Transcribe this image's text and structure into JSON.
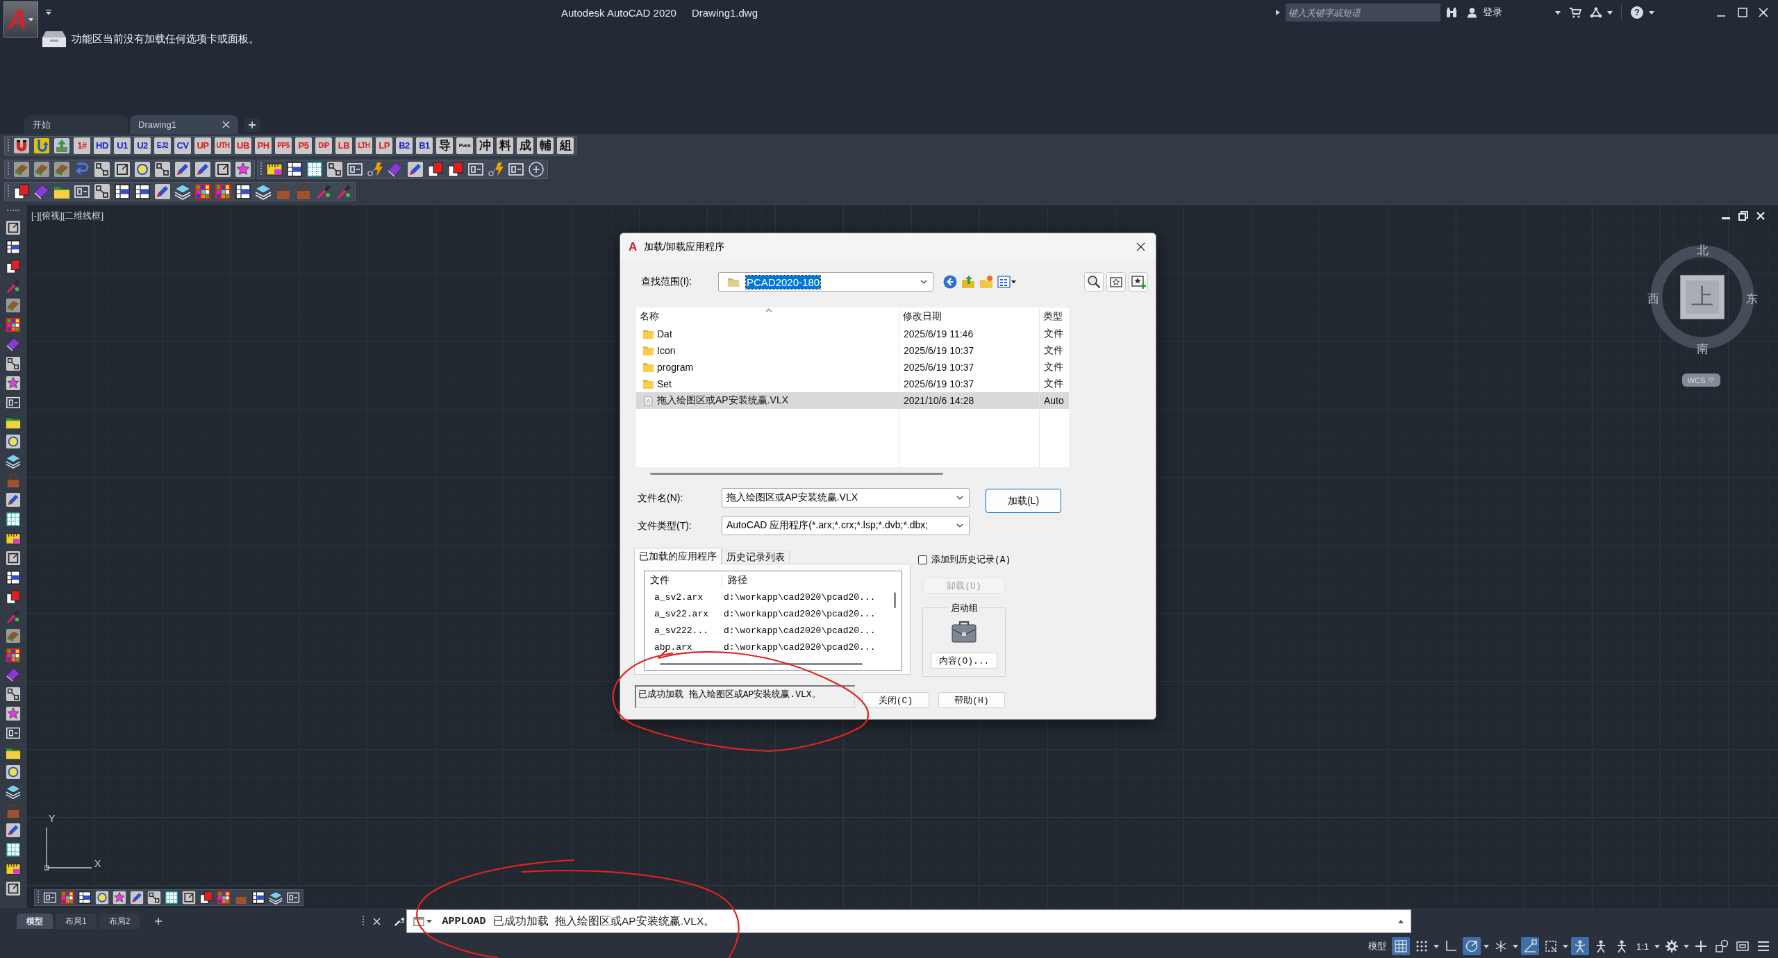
{
  "title_bar": {
    "logo": "A",
    "title": "Autodesk AutoCAD 2020",
    "document": "Drawing1.dwg",
    "search": {
      "placeholder": "键入关键字或短语"
    },
    "sign_in": "登录",
    "help": "?"
  },
  "ribbon": {
    "message": "功能区当前没有加载任何选项卡或面板。"
  },
  "file_tabs": [
    {
      "label": "开始",
      "selected": false,
      "closable": false
    },
    {
      "label": "Drawing1",
      "selected": true,
      "closable": true
    }
  ],
  "toolbar_buttons": [
    {
      "label": "1#",
      "color": "#e01818"
    },
    {
      "label": "HD",
      "color": "#1f1fd0"
    },
    {
      "label": "U1",
      "color": "#1f1fd0"
    },
    {
      "label": "U2",
      "color": "#1f1fd0"
    },
    {
      "label": "EJ2",
      "color": "#1f1fd0"
    },
    {
      "label": "CV",
      "color": "#1f1fd0"
    },
    {
      "label": "UP",
      "color": "#e01818"
    },
    {
      "label": "UTH",
      "color": "#e01818"
    },
    {
      "label": "UB",
      "color": "#e01818"
    },
    {
      "label": "PH",
      "color": "#e01818"
    },
    {
      "label": "PP5",
      "color": "#e01818"
    },
    {
      "label": "P5",
      "color": "#e01818"
    },
    {
      "label": "DIP",
      "color": "#e01818"
    },
    {
      "label": "LB",
      "color": "#e01818"
    },
    {
      "label": "LTH",
      "color": "#e01818"
    },
    {
      "label": "LP",
      "color": "#e01818"
    },
    {
      "label": "B2",
      "color": "#1f1fd0"
    },
    {
      "label": "B1",
      "color": "#1f1fd0"
    },
    {
      "label": "导",
      "color": "#101010"
    },
    {
      "label": "Pves",
      "color": "#101010"
    },
    {
      "label": "冲",
      "color": "#101010"
    },
    {
      "label": "料",
      "color": "#101010"
    },
    {
      "label": "成",
      "color": "#101010"
    },
    {
      "label": "輔",
      "color": "#101010"
    },
    {
      "label": "組",
      "color": "#101010"
    }
  ],
  "viewport": {
    "label": "[-][俯视][二维线框]"
  },
  "viewcube": {
    "north": "北",
    "west": "西",
    "face": "上",
    "east": "东",
    "south": "南",
    "ucs": "WCS"
  },
  "dialog": {
    "logo": "A",
    "title": "加载/卸载应用程序",
    "look_in": {
      "label": "查找范围(I):",
      "value": "PCAD2020-180",
      "focused": true
    },
    "file_list": {
      "columns": [
        "名称",
        "修改日期",
        "类型"
      ],
      "rows": [
        {
          "kind": "folder",
          "name": "Dat",
          "modified": "2025/6/19 11:46",
          "type": "文件",
          "selected": false
        },
        {
          "kind": "folder",
          "name": "Icon",
          "modified": "2025/6/19 10:37",
          "type": "文件",
          "selected": false
        },
        {
          "kind": "folder",
          "name": "program",
          "modified": "2025/6/19 10:37",
          "type": "文件",
          "selected": false
        },
        {
          "kind": "folder",
          "name": "Set",
          "modified": "2025/6/19 10:37",
          "type": "文件",
          "selected": false
        },
        {
          "kind": "file",
          "name": "拖入绘图区或AP安装统赢.VLX",
          "modified": "2021/10/6 14:28",
          "type": "Auto",
          "selected": true
        }
      ]
    },
    "file_name": {
      "label": "文件名(N):",
      "value": "拖入绘图区或AP安装统赢.VLX"
    },
    "file_type": {
      "label": "文件类型(T):",
      "value": "AutoCAD 应用程序(*.arx;*.crx;*.lsp;*.dvb;*.dbx;"
    },
    "load_button": "加载(L)",
    "tabs": [
      {
        "label": "已加载的应用程序",
        "selected": true
      },
      {
        "label": "历史记录列表",
        "selected": false
      }
    ],
    "add_to_history": {
      "label": "添加到历史记录(A)",
      "checked": false
    },
    "loaded_apps": {
      "columns": [
        "文件",
        "路径"
      ],
      "rows": [
        {
          "file": "a_sv2.arx",
          "path": "d:\\workapp\\cad2020\\pcad20..."
        },
        {
          "file": "a_sv22.arx",
          "path": "d:\\workapp\\cad2020\\pcad20..."
        },
        {
          "file": "a_sv222...",
          "path": "d:\\workapp\\cad2020\\pcad20..."
        },
        {
          "file": "abp.arx",
          "path": "d:\\workapp\\cad2020\\pcad20..."
        }
      ]
    },
    "unload_button": {
      "label": "卸载(U)",
      "disabled": true
    },
    "startup_group": {
      "title": "启动组",
      "contents_button": "内容(O)..."
    },
    "status_text": "已成功加载 拖入绘图区或AP安装统赢.VLX。",
    "close_button": "关闭(C)",
    "help_button": "帮助(H)"
  },
  "ucs_icon": {
    "y_axis": "Y",
    "x_axis": "X"
  },
  "layout_tabs": [
    {
      "label": "模型",
      "selected": true
    },
    {
      "label": "布局1",
      "selected": false
    },
    {
      "label": "布局2",
      "selected": false
    }
  ],
  "command_line": {
    "command": "APPLOAD",
    "message": "已成功加载  拖入绘图区或AP安装统赢.VLX。"
  },
  "status_bar": {
    "items": [
      {
        "kind": "label",
        "text": "模型"
      },
      {
        "kind": "grid",
        "on": true
      },
      {
        "kind": "snap",
        "on": false
      },
      {
        "kind": "caret"
      },
      {
        "kind": "ortho",
        "on": false
      },
      {
        "kind": "polar",
        "on": true
      },
      {
        "kind": "caret"
      },
      {
        "kind": "isodraft",
        "on": false
      },
      {
        "kind": "caret"
      },
      {
        "kind": "osnap",
        "on": true
      },
      {
        "kind": "object",
        "on": false
      },
      {
        "kind": "caret"
      },
      {
        "kind": "annotate",
        "on": true
      },
      {
        "kind": "person",
        "on": false
      },
      {
        "kind": "person",
        "on": false
      },
      {
        "kind": "label",
        "text": "1:1"
      },
      {
        "kind": "caret"
      },
      {
        "kind": "gear"
      },
      {
        "kind": "caret"
      },
      {
        "kind": "plus"
      },
      {
        "kind": "isolate"
      },
      {
        "kind": "fullscreen"
      },
      {
        "kind": "menu"
      }
    ]
  }
}
